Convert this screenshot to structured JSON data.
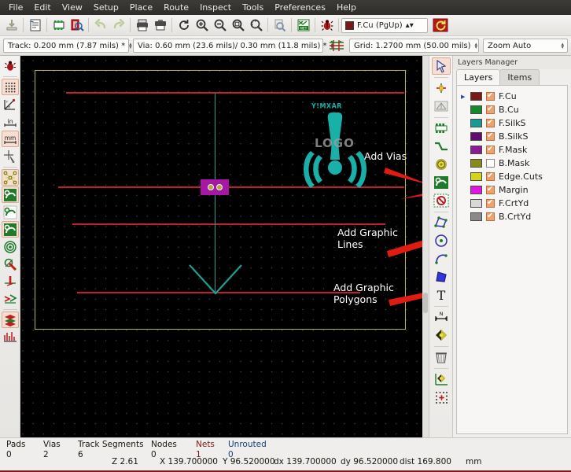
{
  "menu": {
    "items": [
      "File",
      "Edit",
      "View",
      "Setup",
      "Place",
      "Route",
      "Inspect",
      "Tools",
      "Preferences",
      "Help"
    ]
  },
  "toolbar_main": {
    "buttons": [
      {
        "name": "open-board-icon",
        "label": "Open Board"
      },
      {
        "name": "page-settings-icon",
        "label": "Page Settings"
      },
      {
        "name": "footprint-editor-icon",
        "label": "Footprint Editor"
      },
      {
        "name": "print-preview-icon",
        "label": "Print Preview"
      },
      {
        "name": "undo-icon",
        "label": "Undo"
      },
      {
        "name": "redo-icon",
        "label": "Redo"
      },
      {
        "name": "print-icon",
        "label": "Print"
      },
      {
        "name": "plot-icon",
        "label": "Plot"
      },
      {
        "name": "refresh-icon",
        "label": "Refresh"
      },
      {
        "name": "zoom-in-icon",
        "label": "Zoom In"
      },
      {
        "name": "zoom-out-icon",
        "label": "Zoom Out"
      },
      {
        "name": "zoom-fit-icon",
        "label": "Zoom to Fit"
      },
      {
        "name": "zoom-area-icon",
        "label": "Zoom to Selection"
      },
      {
        "name": "find-icon",
        "label": "Find"
      },
      {
        "name": "netlist-icon",
        "label": "Load Netlist"
      },
      {
        "name": "drc-icon",
        "label": "Design Rules Check"
      }
    ]
  },
  "toolbar_aux": {
    "track_width": "Track: 0.200 mm (7.87 mils) *",
    "via_size": "Via: 0.60 mm (23.6 mils)/ 0.30 mm (11.8 mils) *",
    "grid": "Grid: 1.2700 mm (50.00 mils)",
    "zoom": "Zoom Auto",
    "active_layer": "F.Cu (PgUp)",
    "active_layer_color": "#781818",
    "net_highlight_icon": "net-highlight-icon",
    "layer_pair_icon": "layer-pair-icon"
  },
  "left_toolbar": {
    "items": [
      {
        "name": "drc-errors-icon",
        "active": false
      },
      {
        "name": "grid-display-icon",
        "active": true
      },
      {
        "name": "polar-coords-icon",
        "active": false
      },
      {
        "name": "units-inches-icon",
        "active": false
      },
      {
        "name": "units-mm-icon",
        "active": true
      },
      {
        "name": "cursor-shape-icon",
        "active": false
      },
      {
        "name": "show-ratsnest-icon",
        "active": true
      },
      {
        "name": "curved-ratsnest-icon",
        "active": true
      },
      {
        "name": "fill-tracks-icon",
        "active": false
      },
      {
        "name": "fill-vias-icon",
        "active": true
      },
      {
        "name": "fill-zones-icon",
        "active": false
      },
      {
        "name": "hide-pads-icon",
        "active": false
      },
      {
        "name": "show-footprints-front-icon",
        "active": false
      },
      {
        "name": "show-footprints-back-icon",
        "active": false
      },
      {
        "name": "layers-manager-toggle-icon",
        "active": true
      },
      {
        "name": "microwave-tools-icon",
        "active": false
      }
    ]
  },
  "right_toolbar": {
    "items": [
      {
        "name": "select-tool-icon",
        "active": true
      },
      {
        "name": "highlight-net-icon",
        "active": false
      },
      {
        "name": "local-ratsnest-icon",
        "active": false
      },
      {
        "name": "add-footprint-icon",
        "active": false
      },
      {
        "name": "route-track-icon",
        "active": false
      },
      {
        "name": "add-via-icon",
        "active": false
      },
      {
        "name": "add-zone-icon",
        "active": false
      },
      {
        "name": "add-keepout-zone-icon",
        "active": false
      },
      {
        "name": "add-graphic-polygon-icon",
        "active": false
      },
      {
        "name": "add-graphic-circle-icon",
        "active": false
      },
      {
        "name": "add-graphic-arc-icon",
        "active": false
      },
      {
        "name": "add-graphic-filled-polygon-icon",
        "active": false
      },
      {
        "name": "add-text-icon",
        "active": false
      },
      {
        "name": "add-dimension-icon",
        "active": false
      },
      {
        "name": "add-target-icon",
        "active": false
      },
      {
        "name": "delete-icon",
        "active": false
      },
      {
        "name": "set-origin-icon",
        "active": false
      },
      {
        "name": "set-grid-origin-icon",
        "active": false
      }
    ]
  },
  "layers_manager": {
    "title": "Layers Manager",
    "tabs": [
      {
        "label": "Layers",
        "selected": true
      },
      {
        "label": "Items",
        "selected": false
      }
    ],
    "layers": [
      {
        "name": "F.Cu",
        "color": "#781818",
        "visible": true,
        "active": true
      },
      {
        "name": "B.Cu",
        "color": "#14892c",
        "visible": true,
        "active": false
      },
      {
        "name": "F.SilkS",
        "color": "#179b94",
        "visible": true,
        "active": false
      },
      {
        "name": "B.SilkS",
        "color": "#5f0d6e",
        "visible": true,
        "active": false
      },
      {
        "name": "F.Mask",
        "color": "#8a1b94",
        "visible": true,
        "active": false
      },
      {
        "name": "B.Mask",
        "color": "#8a8a1b",
        "visible": false,
        "active": false
      },
      {
        "name": "Edge.Cuts",
        "color": "#d4d419",
        "visible": true,
        "active": false
      },
      {
        "name": "Margin",
        "color": "#e017e0",
        "visible": true,
        "active": false
      },
      {
        "name": "F.CrtYd",
        "color": "#d8d8d8",
        "visible": true,
        "active": false
      },
      {
        "name": "B.CrtYd",
        "color": "#8a8a8a",
        "visible": true,
        "active": false
      }
    ]
  },
  "canvas": {
    "background": "#000000",
    "board_outline_color": "#b9b930",
    "trace_color": "#c21f2e",
    "ratsnest_color": "#1d9f92",
    "silkscreen_color": "#18b0a8",
    "via_pad_color": "#a617a6",
    "silk_reference": "Y!MXAR",
    "logo_text": "LOGO",
    "annotations": [
      {
        "name": "annotation-add-vias",
        "text": "Add Vias"
      },
      {
        "name": "annotation-add-graphic-lines",
        "text": "Add Graphic\nLines"
      },
      {
        "name": "annotation-add-graphic-polygons",
        "text": "Add Graphic\nPolygons"
      }
    ],
    "arrow_color": "#e01b10"
  },
  "statusbar": {
    "counters": [
      {
        "label": "Pads",
        "value": "0",
        "color": "#17170f"
      },
      {
        "label": "Vias",
        "value": "2",
        "color": "#17170f"
      },
      {
        "label": "Track Segments",
        "value": "6",
        "color": "#17170f"
      },
      {
        "label": "Nodes",
        "value": "0",
        "color": "#17170f"
      },
      {
        "label": "Nets",
        "value": "1",
        "color": "#7a1a1a"
      },
      {
        "label": "Unrouted",
        "value": "0",
        "color": "#14407a"
      }
    ],
    "zoom": "Z 2.61",
    "coord_x": "X 139.700000",
    "coord_y": "Y 96.520000",
    "delta_x": "dx 139.700000",
    "delta_y": "dy 96.520000",
    "dist": "dist 169.800",
    "units": "mm"
  }
}
